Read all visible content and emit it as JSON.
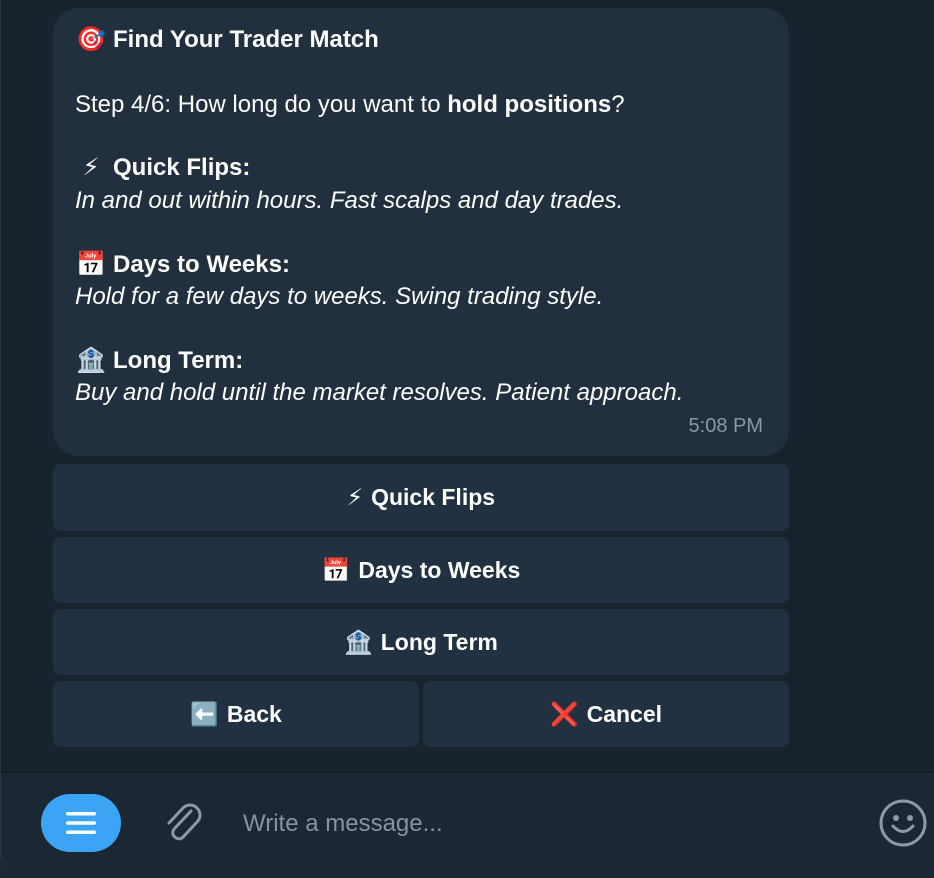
{
  "message": {
    "title": {
      "emoji": "🎯",
      "text": "Find Your Trader Match"
    },
    "step": {
      "prefix": "Step 4/6: How long do you want to ",
      "bold": "hold positions",
      "suffix": "?"
    },
    "options": [
      {
        "emoji": "⚡",
        "title": "Quick Flips:",
        "desc": "In and out within hours. Fast scalps and day trades."
      },
      {
        "emoji": "📅",
        "title": "Days to Weeks:",
        "desc": "Hold for a few days to weeks. Swing trading style."
      },
      {
        "emoji": "🏦",
        "title": "Long Term:",
        "desc": "Buy and hold until the market resolves. Patient approach."
      }
    ],
    "time": "5:08 PM"
  },
  "keyboard": {
    "quick_flips": {
      "emoji": "⚡",
      "label": "Quick Flips"
    },
    "days_to_weeks": {
      "emoji": "📅",
      "label": "Days to Weeks"
    },
    "long_term": {
      "emoji": "🏦",
      "label": "Long Term"
    },
    "back": {
      "emoji": "⬅️",
      "label": "Back"
    },
    "cancel": {
      "emoji": "❌",
      "label": "Cancel"
    }
  },
  "composer": {
    "placeholder": "Write a message...",
    "icons": {
      "menu": "menu-icon",
      "attach": "paperclip-icon",
      "emoji": "smiley-icon"
    },
    "accent": "#3ba4f5"
  }
}
